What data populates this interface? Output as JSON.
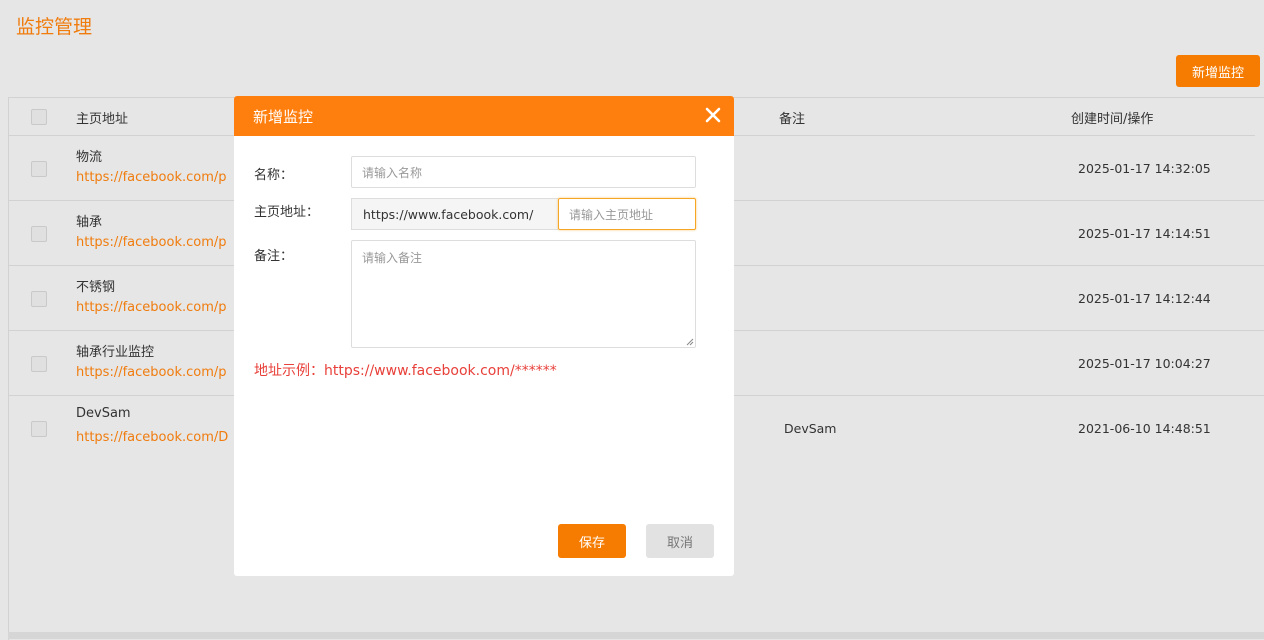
{
  "page": {
    "title": "监控管理",
    "add_button": "新增监控"
  },
  "table": {
    "headers": {
      "url": "主页地址",
      "note": "备注",
      "time_ops": "创建时间/操作"
    },
    "rows": [
      {
        "name": "物流",
        "url": "https://facebook.com/p",
        "note": "",
        "time": "2025-01-17 14:32:05"
      },
      {
        "name": "轴承",
        "url": "https://facebook.com/p",
        "note": "",
        "time": "2025-01-17 14:14:51"
      },
      {
        "name": "不锈钢",
        "url": "https://facebook.com/p",
        "note": "",
        "time": "2025-01-17 14:12:44"
      },
      {
        "name": "轴承行业监控",
        "url": "https://facebook.com/p",
        "note": "",
        "time": "2025-01-17 10:04:27"
      },
      {
        "name": "DevSam",
        "url": "https://facebook.com/D",
        "note": "DevSam",
        "time": "2021-06-10 14:48:51"
      }
    ]
  },
  "modal": {
    "title": "新增监控",
    "name_label": "名称：",
    "name_placeholder": "请输入名称",
    "url_label": "主页地址：",
    "url_prefix": "https://www.facebook.com/",
    "url_placeholder": "请输入主页地址",
    "note_label": "备注：",
    "note_placeholder": "请输入备注",
    "hint": "地址示例：https://www.facebook.com/******",
    "save": "保存",
    "cancel": "取消"
  },
  "colors": {
    "accent": "#f57c00",
    "header": "#ff7f0e",
    "hint": "#e8403a"
  }
}
